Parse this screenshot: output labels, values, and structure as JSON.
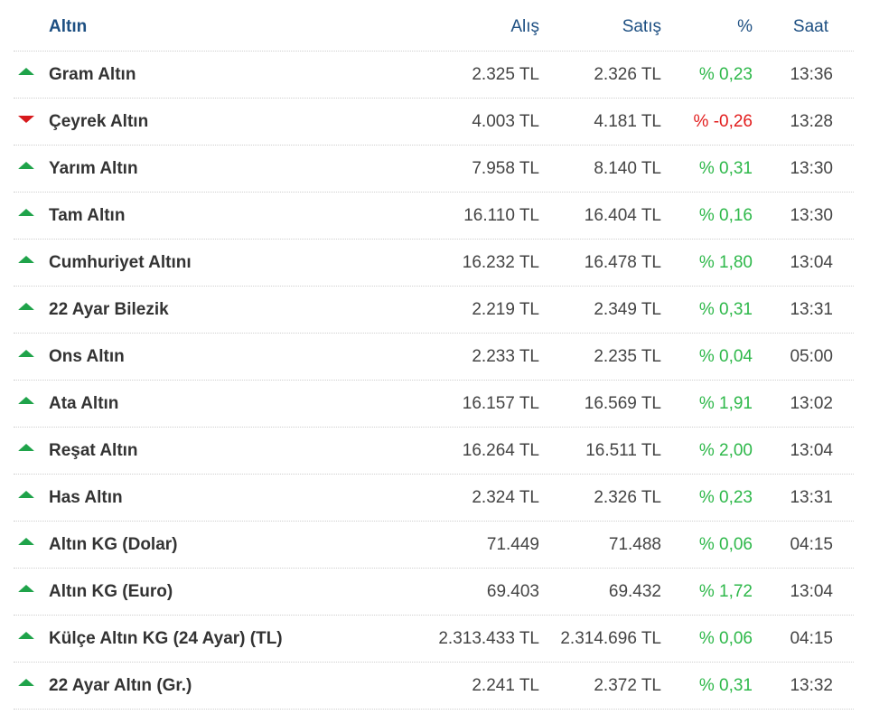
{
  "header": {
    "name": "Altın",
    "buy": "Alış",
    "sell": "Satış",
    "pct": "%",
    "time": "Saat"
  },
  "colors": {
    "header_text": "#1d4f82",
    "up": "#2eb84a",
    "down": "#e21d1d"
  },
  "rows": [
    {
      "name": "Gram Altın",
      "buy": "2.325 TL",
      "sell": "2.326 TL",
      "pct": "% 0,23",
      "time": "13:36",
      "trend": "up",
      "icon": "triangle-up-icon"
    },
    {
      "name": "Çeyrek Altın",
      "buy": "4.003 TL",
      "sell": "4.181 TL",
      "pct": "% -0,26",
      "time": "13:28",
      "trend": "down",
      "icon": "triangle-down-icon"
    },
    {
      "name": "Yarım Altın",
      "buy": "7.958 TL",
      "sell": "8.140 TL",
      "pct": "% 0,31",
      "time": "13:30",
      "trend": "up",
      "icon": "triangle-up-icon"
    },
    {
      "name": "Tam Altın",
      "buy": "16.110 TL",
      "sell": "16.404 TL",
      "pct": "% 0,16",
      "time": "13:30",
      "trend": "up",
      "icon": "triangle-up-icon"
    },
    {
      "name": "Cumhuriyet Altını",
      "buy": "16.232 TL",
      "sell": "16.478 TL",
      "pct": "% 1,80",
      "time": "13:04",
      "trend": "up",
      "icon": "triangle-up-icon"
    },
    {
      "name": "22 Ayar Bilezik",
      "buy": "2.219 TL",
      "sell": "2.349 TL",
      "pct": "% 0,31",
      "time": "13:31",
      "trend": "up",
      "icon": "triangle-up-icon"
    },
    {
      "name": "Ons Altın",
      "buy": "2.233 TL",
      "sell": "2.235 TL",
      "pct": "% 0,04",
      "time": "05:00",
      "trend": "up",
      "icon": "triangle-up-icon"
    },
    {
      "name": "Ata Altın",
      "buy": "16.157 TL",
      "sell": "16.569 TL",
      "pct": "% 1,91",
      "time": "13:02",
      "trend": "up",
      "icon": "triangle-up-icon"
    },
    {
      "name": "Reşat Altın",
      "buy": "16.264 TL",
      "sell": "16.511 TL",
      "pct": "% 2,00",
      "time": "13:04",
      "trend": "up",
      "icon": "triangle-up-icon"
    },
    {
      "name": "Has Altın",
      "buy": "2.324 TL",
      "sell": "2.326 TL",
      "pct": "% 0,23",
      "time": "13:31",
      "trend": "up",
      "icon": "triangle-up-icon"
    },
    {
      "name": "Altın KG (Dolar)",
      "buy": "71.449",
      "sell": "71.488",
      "pct": "% 0,06",
      "time": "04:15",
      "trend": "up",
      "icon": "triangle-up-icon"
    },
    {
      "name": "Altın KG (Euro)",
      "buy": "69.403",
      "sell": "69.432",
      "pct": "% 1,72",
      "time": "13:04",
      "trend": "up",
      "icon": "triangle-up-icon"
    },
    {
      "name": "Külçe Altın KG (24 Ayar) (TL)",
      "buy": "2.313.433 TL",
      "sell": "2.314.696 TL",
      "pct": "% 0,06",
      "time": "04:15",
      "trend": "up",
      "icon": "triangle-up-icon"
    },
    {
      "name": "22 Ayar Altın (Gr.)",
      "buy": "2.241 TL",
      "sell": "2.372 TL",
      "pct": "% 0,31",
      "time": "13:32",
      "trend": "up",
      "icon": "triangle-up-icon"
    }
  ]
}
